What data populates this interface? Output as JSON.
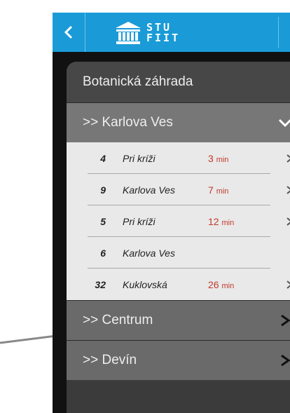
{
  "header": {
    "logo_line1": "STU",
    "logo_line2": "FIIT"
  },
  "stop": {
    "title": "Botanická záhrada"
  },
  "groups": [
    {
      "label": ">> Karlova Ves",
      "expanded": true,
      "rows": [
        {
          "line": "4",
          "destination": "Pri kríži",
          "time": "3",
          "unit": "min"
        },
        {
          "line": "9",
          "destination": "Karlova Ves",
          "time": "7",
          "unit": "min"
        },
        {
          "line": "5",
          "destination": "Pri kríži",
          "time": "12",
          "unit": "min"
        },
        {
          "line": "6",
          "destination": "Karlova Ves",
          "time": "",
          "unit": ""
        },
        {
          "line": "32",
          "destination": "Kuklovská",
          "time": "26",
          "unit": "min"
        }
      ]
    },
    {
      "label": ">> Centrum",
      "expanded": false
    },
    {
      "label": ">> Devín",
      "expanded": false
    }
  ],
  "colors": {
    "header": "#1a9bd7",
    "time": "#c0392b"
  }
}
